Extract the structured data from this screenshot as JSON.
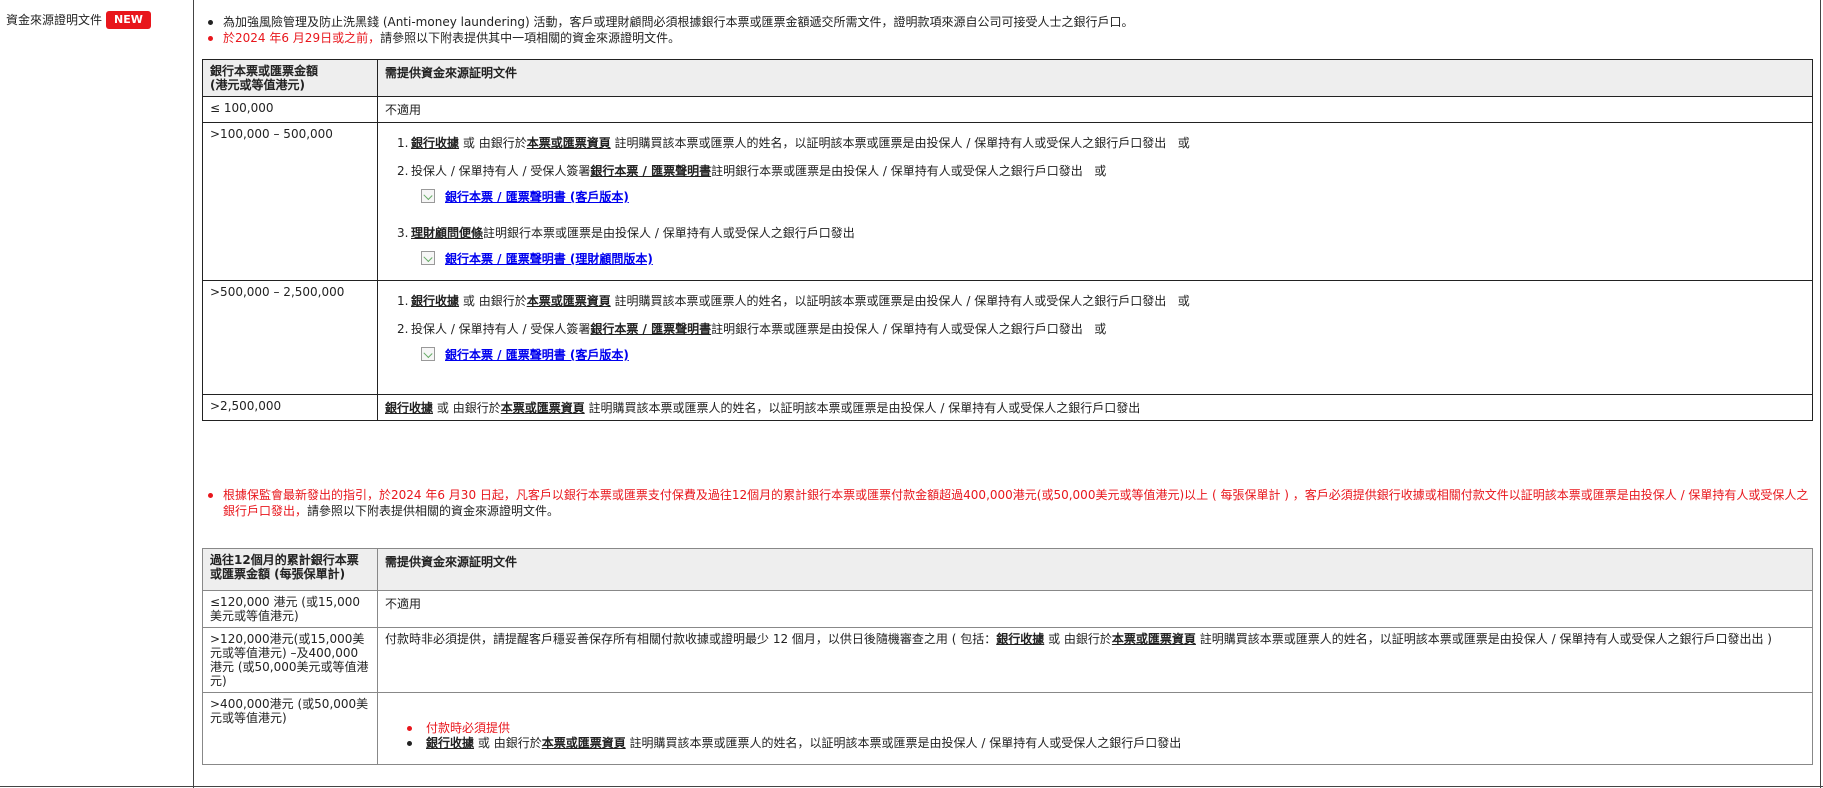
{
  "section": {
    "label": "資金來源證明文件",
    "badge": "NEW"
  },
  "intro": {
    "bullet1": "為加強風險管理及防止洗黑錢 (Anti-money laundering) 活動，客戶或理財顧問必須根據銀行本票或匯票金額遞交所需文件，證明款項來源自公司可接受人士之銀行戶口。",
    "bullet2_red": "於2024 年6 月29日或之前，",
    "bullet2_rest": "請參照以下附表提供其中一項相關的資金來源證明文件。"
  },
  "terms": {
    "bank_receipt": "銀行收據",
    "or": "或",
    "cheque_copy": "本票或匯票資頁",
    "declaration": "銀行本票 / 匯票聲明書",
    "advisor_note": "理財顧問便條"
  },
  "phrases": {
    "bank_receipt_tail": "由銀行於",
    "cheque_tail": "註明購買該本票或匯票人的姓名，以証明該本票或匯票是由投保人 / 保單持有人或受保人之銀行戶口發出",
    "or_suffix": "或",
    "sign_prefix": "投保人 / 保單持有人 / 受保人簽署",
    "sign_tail": "註明銀行本票或匯票是由投保人 / 保單持有人或受保人之銀行戶口發出",
    "advisor_tail": "註明銀行本票或匯票是由投保人 / 保單持有人或受保人之銀行戶口發出"
  },
  "table1": {
    "header_col1": "銀行本票或匯票金額\n(港元或等值港元)",
    "header_col2": "需提供資金來源証明文件",
    "rows": [
      {
        "amount": "≤ 100,000",
        "doc": "不適用"
      },
      {
        "amount": ">100,000 – 500,000"
      },
      {
        "amount": ">500,000 – 2,500,000"
      },
      {
        "amount": ">2,500,000"
      }
    ],
    "link_client": "銀行本票 / 匯票聲明書 (客戶版本)",
    "link_advisor": "銀行本票 / 匯票聲明書 (理財顧問版本)"
  },
  "notice": {
    "red": "根據保監會最新發出的指引，於2024 年6 月30 日起，凡客戶以銀行本票或匯票支付保費及過往12個月的累計銀行本票或匯票付款金額超過400,000港元(或50,000美元或等值港元)以上 ( 每張保單計 ) ，客戶必須提供銀行收據或相關付款文件以証明該本票或匯票是由投保人 / 保單持有人或受保人之銀行戶口發出，",
    "rest": "請參照以下附表提供相關的資金來源證明文件。"
  },
  "table2": {
    "header_col1": "過往12個月的累計銀行本票或匯票金額 (每張保單計)",
    "header_col2": "需提供資金來源証明文件",
    "row1_amount": "≤120,000 港元 (或15,000美元或等值港元)",
    "row1_doc": "不適用",
    "row2_amount": ">120,000港元(或15,000美元或等值港元) –及400,000 港元 (或50,000美元或等值港元)",
    "row2_doc_prefix": "付款時非必須提供，請提醒客戶穩妥善保存所有相關付款收據或證明最少 12 個月，以供日後隨機審查之用 ( 包括：",
    "row2_doc_suffix": "出 )",
    "row3_amount": ">400,000港元 (或50,000美元或等值港元)",
    "row3_bullet1": "付款時必須提供"
  }
}
